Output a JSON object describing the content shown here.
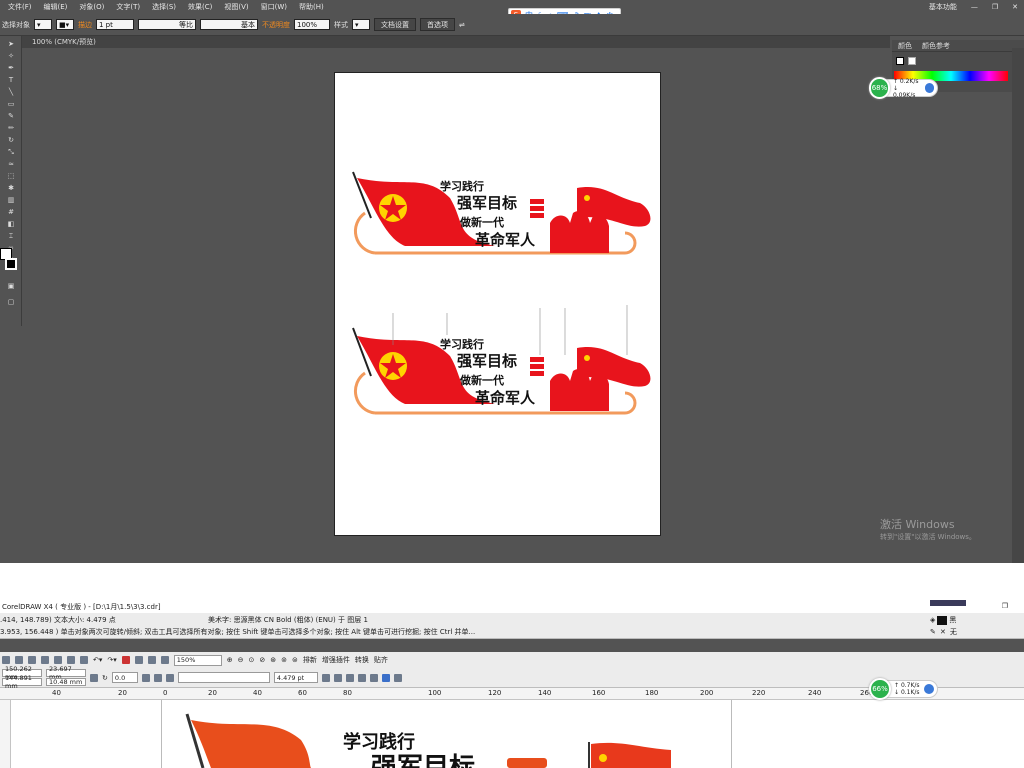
{
  "ai": {
    "menu": [
      "文件(F)",
      "编辑(E)",
      "对象(O)",
      "文字(T)",
      "选择(S)",
      "效果(C)",
      "视图(V)",
      "窗口(W)",
      "帮助(H)"
    ],
    "workspace": "基本功能",
    "control": {
      "selection_label": "选择对象",
      "stroke_label": "描边",
      "stroke_value": "1 pt",
      "profile1": "等比",
      "profile2": "基本",
      "opacity_label": "不透明度",
      "opacity_value": "100%",
      "style_label": "样式",
      "doc_setup": "文档设置",
      "preferences": "首选项"
    },
    "doc_tab": "100% (CMYK/预览)",
    "panel_tabs": [
      "颜色",
      "颜色参考"
    ],
    "speed": {
      "pct": "68%",
      "up": "0.2K/s",
      "down": "0.09K/s"
    }
  },
  "ime": {
    "lang": "中",
    "icons": [
      "moon-icon",
      "dot-icon",
      "keyboard-icon",
      "mic-icon",
      "grid-icon",
      "shirt-icon",
      "gear-icon"
    ]
  },
  "windows_watermark": {
    "title": "激活 Windows",
    "sub": "转到\"设置\"以激活 Windows。"
  },
  "artwork": {
    "line1": "学习践行",
    "line2": "强军目标",
    "line3": "做新一代",
    "line4": "革命军人",
    "star_char": "八"
  },
  "corel": {
    "title": "CorelDRAW X4 ( 专业版 ) - [D:\\1月\\1.5\\3\\3.cdr]",
    "status_line1": ".414, 148.789) 文本大小: 4.479 点",
    "status_mid": "美术字: 思源黑体 CN Bold (粗体) (ENU) 于 图层 1",
    "status_line2": "3.953, 156.448 ) 单击对象两次可旋转/倾斜; 双击工具可选择所有对象; 按住 Shift 键单击可选择多个对象; 按住 Alt 键单击可进行挖掘; 按住 Ctrl 并单...",
    "fill_label": "黑",
    "outline_label": "无",
    "zoom": "150%",
    "tb_labels": [
      "排新",
      "增强插件",
      "转换",
      "贴齐"
    ],
    "pos_x": "150.262 mm",
    "pos_y": "144.891 mm",
    "size_w": "23.697 mm",
    "size_h": "10.48 mm",
    "angle": "0.0",
    "font_size": "4.479 pt",
    "ruler_ticks": [
      "40",
      "20",
      "0",
      "20",
      "40",
      "60",
      "80",
      "100",
      "120",
      "140",
      "160",
      "180",
      "200",
      "220",
      "240",
      "260",
      "280"
    ],
    "speed": {
      "pct": "66%",
      "up": "0.7K/s",
      "down": "0.1K/s"
    }
  },
  "palette": {
    "red": "#e8141c",
    "orange_line": "#f29a5c",
    "flag_red": "#d9191c",
    "star": "#ffd400"
  }
}
